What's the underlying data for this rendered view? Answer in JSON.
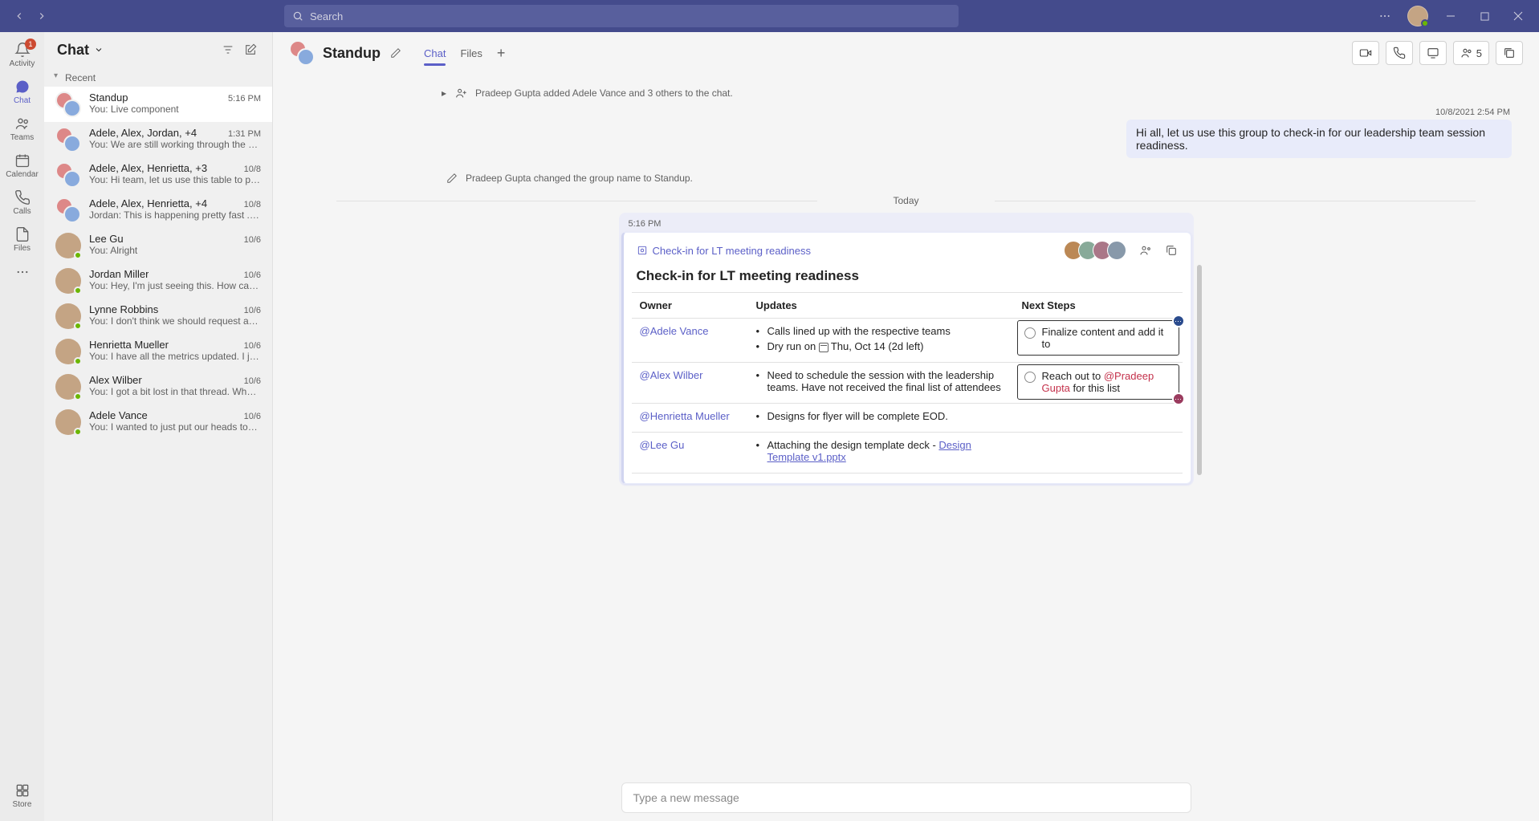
{
  "titlebar": {
    "search_placeholder": "Search",
    "activity_badge": "1"
  },
  "rail": {
    "activity": "Activity",
    "chat": "Chat",
    "teams": "Teams",
    "calendar": "Calendar",
    "calls": "Calls",
    "files": "Files",
    "store": "Store"
  },
  "chatlist": {
    "title": "Chat",
    "recent": "Recent",
    "items": [
      {
        "name": "Standup",
        "time": "5:16 PM",
        "preview": "You: Live component",
        "group": true
      },
      {
        "name": "Adele, Alex, Jordan, +4",
        "time": "1:31 PM",
        "preview": "You: We are still working through the details, b...",
        "group": true
      },
      {
        "name": "Adele, Alex, Henrietta, +3",
        "time": "10/8",
        "preview": "You: Hi team, let us use this table to provide upd...",
        "group": true
      },
      {
        "name": "Adele, Alex, Henrietta, +4",
        "time": "10/8",
        "preview": "Jordan: This is happening pretty fast ... can some...",
        "group": true
      },
      {
        "name": "Lee Gu",
        "time": "10/6",
        "preview": "You: Alright",
        "group": false
      },
      {
        "name": "Jordan Miller",
        "time": "10/6",
        "preview": "You: Hey, I'm just seeing this. How can I help? W...",
        "group": false
      },
      {
        "name": "Lynne Robbins",
        "time": "10/6",
        "preview": "You: I don't think we should request agency bud...",
        "group": false
      },
      {
        "name": "Henrietta Mueller",
        "time": "10/6",
        "preview": "You: I have all the metrics updated. I just need th...",
        "group": false
      },
      {
        "name": "Alex Wilber",
        "time": "10/6",
        "preview": "You: I got a bit lost in that thread. When is this pr...",
        "group": false
      },
      {
        "name": "Adele Vance",
        "time": "10/6",
        "preview": "You: I wanted to just put our heads together and...",
        "group": false
      }
    ]
  },
  "convo": {
    "title": "Standup",
    "tabs": {
      "chat": "Chat",
      "files": "Files"
    },
    "people_count": "5",
    "sys_added": "Pradeep Gupta added Adele Vance and 3 others to the chat.",
    "msg1_ts": "10/8/2021 2:54 PM",
    "msg1_txt": "Hi all, let us use this group to check-in for our leadership team session readiness.",
    "sys_renamed": "Pradeep Gupta changed the group name to Standup.",
    "today": "Today",
    "comp_ts": "5:16 PM",
    "comp_link": "Check-in for LT meeting readiness",
    "comp_title": "Check-in for LT meeting readiness",
    "cols": {
      "owner": "Owner",
      "updates": "Updates",
      "next": "Next Steps"
    },
    "rows": [
      {
        "owner": "@Adele Vance",
        "updates": [
          "Calls lined up with the respective teams",
          "Dry run on |CAL|Thu, Oct 14 (2d left)"
        ],
        "next": {
          "text": "Finalize content and add it to",
          "boxed": true,
          "cursor": "blue"
        }
      },
      {
        "owner": "@Alex Wilber",
        "updates": [
          "Need to schedule the session with the leadership teams. Have not received the final list of attendees"
        ],
        "next": {
          "prefix": "Reach out to ",
          "mention": "@Pradeep Gupta",
          "suffix": " for this list",
          "boxed": true,
          "cursor": "red"
        }
      },
      {
        "owner": "@Henrietta Mueller",
        "updates": [
          "Designs for flyer will be complete EOD."
        ]
      },
      {
        "owner": "@Lee Gu",
        "updates": [
          "Attaching the design template deck - |LINK|Design Template v1.pptx"
        ]
      }
    ],
    "compose_placeholder": "Type a new message"
  }
}
